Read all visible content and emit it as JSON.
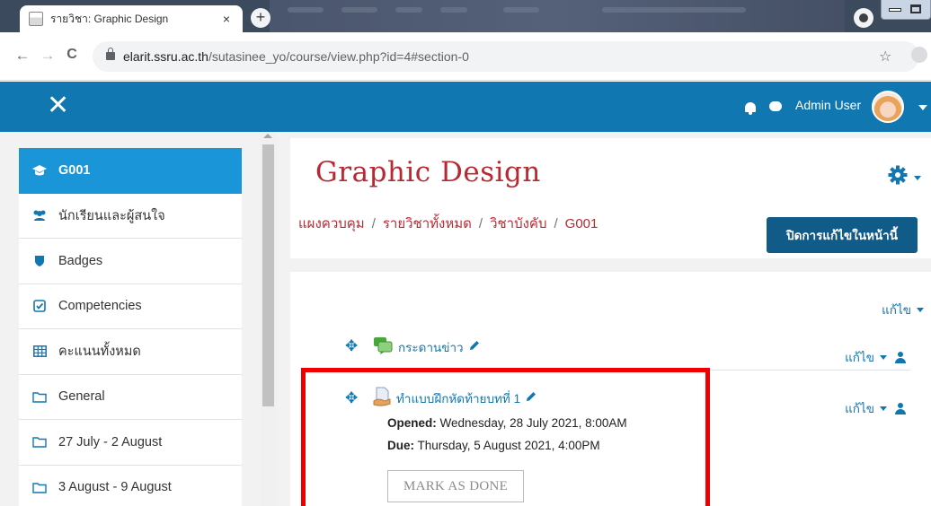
{
  "browser": {
    "tab_title": "รายวิชา: Graphic Design",
    "new_tab_symbol": "+",
    "close_symbol": "×",
    "url_host": "elarit.ssru.ac.th",
    "url_rest": "/sutasinee_yo/course/view.php?id=4#section-0",
    "back": "←",
    "forward": "→",
    "reload": "C",
    "bookmark": "☆"
  },
  "navbar": {
    "close_drawer": "✕",
    "user_name": "Admin User",
    "bg_color": "#1177b0"
  },
  "drawer": {
    "items": [
      {
        "label": "G001",
        "icon": "graduation-cap-icon",
        "active": true
      },
      {
        "label": "นักเรียนและผู้สนใจ",
        "icon": "users-icon"
      },
      {
        "label": "Badges",
        "icon": "shield-icon"
      },
      {
        "label": "Competencies",
        "icon": "check-square-icon"
      },
      {
        "label": "คะแนนทั้งหมด",
        "icon": "table-icon"
      },
      {
        "label": "General",
        "icon": "folder-icon"
      },
      {
        "label": "27 July - 2 August",
        "icon": "folder-icon"
      },
      {
        "label": "3 August - 9 August",
        "icon": "folder-icon"
      }
    ]
  },
  "header": {
    "course_title": "Graphic Design",
    "breadcrumb": [
      "แผงควบคุม",
      "รายวิชาทั้งหมด",
      "วิชาบังคับ",
      "G001"
    ],
    "breadcrumb_sep": "/",
    "turn_editing_off": "ปิดการแก้ไขในหน้านี้"
  },
  "section": {
    "edit_label": "แก้ไข",
    "activities": [
      {
        "name": "กระดานข่าว",
        "icon": "forum-icon",
        "edit_label": "แก้ไข"
      },
      {
        "name": "ทำแบบฝึกหัดท้ายบทที่ 1",
        "icon": "assignment-icon",
        "edit_label": "แก้ไข",
        "opened_label": "Opened:",
        "opened_value": "Wednesday, 28 July 2021, 8:00AM",
        "due_label": "Due:",
        "due_value": "Thursday, 5 August 2021, 4:00PM",
        "mark_done": "MARK AS DONE"
      }
    ]
  },
  "colors": {
    "accent": "#1177b0",
    "drawer_active": "#1a95d8",
    "course_title": "#b72a32",
    "highlight": "#ee0000"
  }
}
